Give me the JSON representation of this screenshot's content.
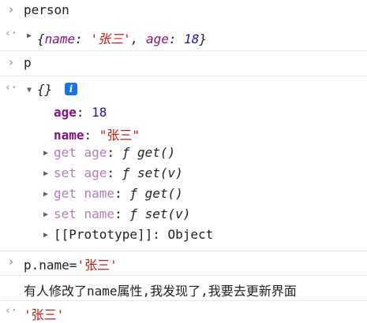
{
  "console": {
    "input1": "person",
    "output1": {
      "prefix": "{",
      "k1": "name",
      "colon": ": ",
      "v1": "'张三'",
      "comma": ", ",
      "k2": "age",
      "v2": "18",
      "suffix": "}"
    },
    "input2": "p",
    "output2": {
      "header": "{}",
      "info_glyph": "i",
      "props": [
        {
          "key": "age",
          "value": "18"
        },
        {
          "key": "name",
          "value": "\"张三\""
        }
      ],
      "accessors": [
        {
          "label": "get age",
          "fn": "ƒ get()"
        },
        {
          "label": "set age",
          "fn": "ƒ set(v)"
        },
        {
          "label": "get name",
          "fn": "ƒ get()"
        },
        {
          "label": "set name",
          "fn": "ƒ set(v)"
        }
      ],
      "prototype_label": "[[Prototype]]",
      "prototype_value": "Object"
    },
    "input3_code": "p.name=",
    "input3_str": "'张三'",
    "log_line": "有人修改了name属性,我发现了,我要去更新界面",
    "result": "'张三'"
  },
  "glyphs": {
    "input_prompt": "›",
    "output_arrow": "‹·",
    "collapsed": "▶",
    "expanded": "▼"
  }
}
